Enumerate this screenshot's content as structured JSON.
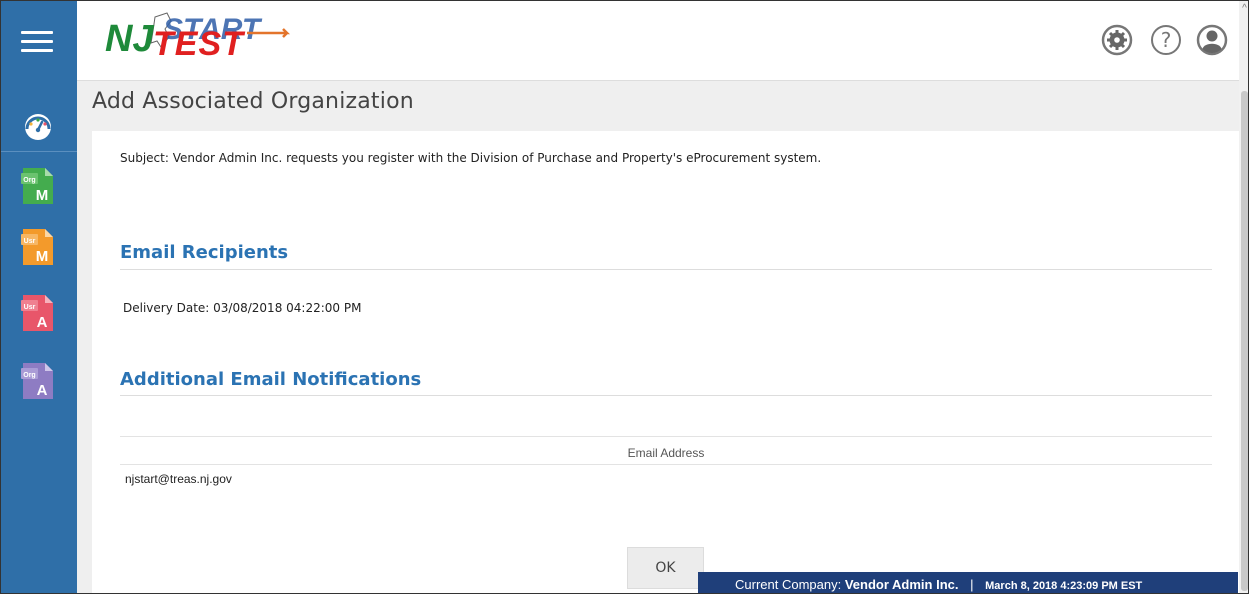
{
  "app": {
    "logo_text": "NJSTART",
    "logo_overlay": "TEST"
  },
  "sidebar": {
    "items": [
      {
        "name": "dashboard",
        "badge": ""
      },
      {
        "name": "org-manage",
        "badge": "Org",
        "letter": "M",
        "color": "#3aa845"
      },
      {
        "name": "user-manage",
        "badge": "Usr",
        "letter": "M",
        "color": "#f39a2b"
      },
      {
        "name": "user-add",
        "badge": "Usr",
        "letter": "A",
        "color": "#e8566a"
      },
      {
        "name": "org-add",
        "badge": "Org",
        "letter": "A",
        "color": "#8e7cc3"
      }
    ]
  },
  "header": {
    "icons": [
      "gear-icon",
      "help-icon",
      "user-icon"
    ]
  },
  "page": {
    "title": "Add Associated Organization"
  },
  "content": {
    "subject": "Subject:  Vendor Admin Inc. requests you register with the Division of Purchase and Property's eProcurement system.",
    "email_recipients_title": "Email Recipients",
    "delivery_date": "Delivery Date:  03/08/2018 04:22:00 PM",
    "additional_title": "Additional Email Notifications",
    "table": {
      "header": "Email Address",
      "rows": [
        "njstart@treas.nj.gov"
      ]
    },
    "ok_label": "OK"
  },
  "statusbar": {
    "company_label": "Current Company:",
    "company_name": "Vendor Admin Inc.",
    "separator": "|",
    "date": "March 8, 2018 4:23:09 PM EST"
  },
  "colors": {
    "sidebar": "#2f6fa8",
    "accent": "#2b73b3",
    "statusbar": "#1f3f7a"
  }
}
